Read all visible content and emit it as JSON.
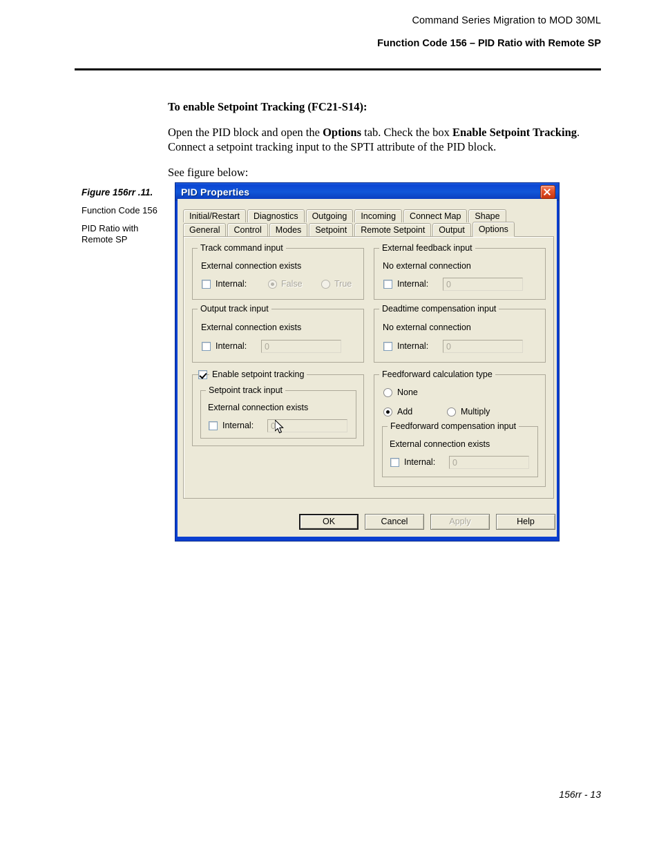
{
  "page": {
    "header_top": "Command Series Migration to MOD 30ML",
    "header_title": "Function Code 156 – PID Ratio with Remote SP",
    "footer": "156rr - 13"
  },
  "body": {
    "heading": "To enable Setpoint Tracking (FC21-S14):",
    "para1_a": "Open the PID block and open the ",
    "para1_b": "Options",
    "para1_c": " tab. Check the box ",
    "para1_d": "Enable Setpoint Tracking",
    "para1_e": ". Connect a setpoint tracking input to the SPTI attribute of the PID block.",
    "para2": "See figure below:"
  },
  "figure": {
    "title": "Figure 156rr .11.",
    "sub1": "Function Code 156",
    "sub2": "PID Ratio with Remote SP"
  },
  "dialog": {
    "title": "PID Properties",
    "close_icon": "close-icon",
    "tabs_row1": [
      {
        "label": "Initial/Restart",
        "active": false
      },
      {
        "label": "Diagnostics",
        "active": false
      },
      {
        "label": "Outgoing",
        "active": false
      },
      {
        "label": "Incoming",
        "active": false
      },
      {
        "label": "Connect Map",
        "active": false
      },
      {
        "label": "Shape",
        "active": false
      }
    ],
    "tabs_row2": [
      {
        "label": "General",
        "active": false
      },
      {
        "label": "Control",
        "active": false
      },
      {
        "label": "Modes",
        "active": false
      },
      {
        "label": "Setpoint",
        "active": false
      },
      {
        "label": "Remote Setpoint",
        "active": false
      },
      {
        "label": "Output",
        "active": false
      },
      {
        "label": "Options",
        "active": true
      }
    ],
    "groups": {
      "track_command": {
        "legend": "Track command input",
        "status": "External connection exists",
        "internal_label": "Internal:",
        "internal_checked": false,
        "radio_false": "False",
        "radio_true": "True",
        "radio_selected": "False",
        "radios_disabled": true
      },
      "external_feedback": {
        "legend": "External feedback input",
        "status": "No external connection",
        "internal_label": "Internal:",
        "internal_checked": false,
        "value": "0"
      },
      "output_track": {
        "legend": "Output track input",
        "status": "External connection exists",
        "internal_label": "Internal:",
        "internal_checked": false,
        "value": "0"
      },
      "deadtime_comp": {
        "legend": "Deadtime compensation input",
        "status": "No external connection",
        "internal_label": "Internal:",
        "internal_checked": false,
        "value": "0"
      },
      "enable_setpoint_tracking": {
        "legend": "Enable setpoint tracking",
        "checked": true,
        "inner": {
          "legend": "Setpoint track input",
          "status": "External connection exists",
          "internal_label": "Internal:",
          "internal_checked": false,
          "value": "0"
        }
      },
      "feedforward": {
        "legend": "Feedforward calculation type",
        "option_none": "None",
        "option_add": "Add",
        "option_multiply": "Multiply",
        "selected": "Add",
        "inner": {
          "legend": "Feedforward compensation input",
          "status": "External connection exists",
          "internal_label": "Internal:",
          "internal_checked": false,
          "value": "0"
        }
      }
    },
    "buttons": {
      "ok": "OK",
      "cancel": "Cancel",
      "apply": "Apply",
      "help": "Help"
    }
  },
  "colors": {
    "titlebar_blue": "#0b46d4",
    "dialog_frame": "#0a3fd0",
    "face": "#ece9d8",
    "close_red": "#c83510"
  }
}
